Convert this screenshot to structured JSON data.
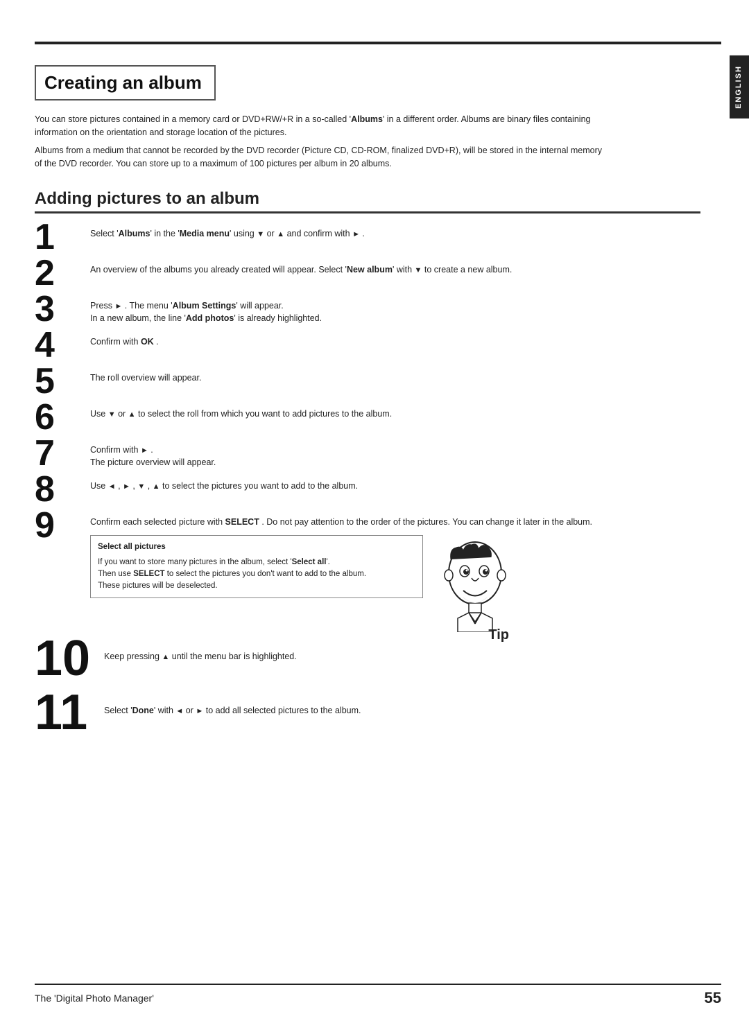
{
  "side_tab": {
    "label": "ENGLISH"
  },
  "section1": {
    "title": "Creating an album",
    "para1": "You can store pictures contained in a memory card or DVD+RW/+R in a so-called 'Albums' in a different order. Albums are binary files containing information on the orientation and storage location of the pictures.",
    "para2": "Albums from a medium that cannot be recorded by the DVD recorder (Picture CD, CD-ROM, finalized DVD+R), will be stored in the internal memory of the DVD recorder. You can store up to a maximum of 100 pictures per album in 20 albums."
  },
  "section2": {
    "title": "Adding pictures to an album",
    "steps": [
      {
        "number": "1",
        "text": "Select 'Albums' in the 'Media menu' using ▼ or ▲ and confirm with ► ."
      },
      {
        "number": "2",
        "text": "An overview of the albums you already created will appear. Select 'New album' with ▼ to create a new album."
      },
      {
        "number": "3",
        "text": "Press ► . The menu 'Album Settings' will appear.\nIn a new album, the line 'Add photos' is already highlighted."
      },
      {
        "number": "4",
        "text": "Confirm with OK ."
      },
      {
        "number": "5",
        "text": "The roll overview will appear."
      },
      {
        "number": "6",
        "text": "Use ▼ or ▲ to select the roll from which you want to add pictures to the album."
      },
      {
        "number": "7",
        "text": "Confirm with ► .\nThe picture overview will appear."
      },
      {
        "number": "8",
        "text": "Use ◄ , ► , ▼ , ▲ to select the pictures you want to add to the album."
      },
      {
        "number": "9",
        "text": "Confirm each selected picture with SELECT . Do not pay attention to the order of the pictures. You can change it later in the album."
      },
      {
        "number": "10",
        "text": "Keep pressing ▲ until the menu bar is highlighted.",
        "large": true
      },
      {
        "number": "11",
        "text": "Select 'Done' with ◄ or ► to add all selected pictures to the album.",
        "large": true
      }
    ],
    "tip": {
      "title": "Select all pictures",
      "line1": "If you want to store many pictures in the album, select 'Select all'.",
      "line2": "Then use SELECT to select the pictures you don't want to add to the album.",
      "line3": "These pictures will be deselected.",
      "label": "Tip"
    }
  },
  "footer": {
    "title": "The 'Digital Photo Manager'",
    "page": "55"
  },
  "connector_word": "and"
}
